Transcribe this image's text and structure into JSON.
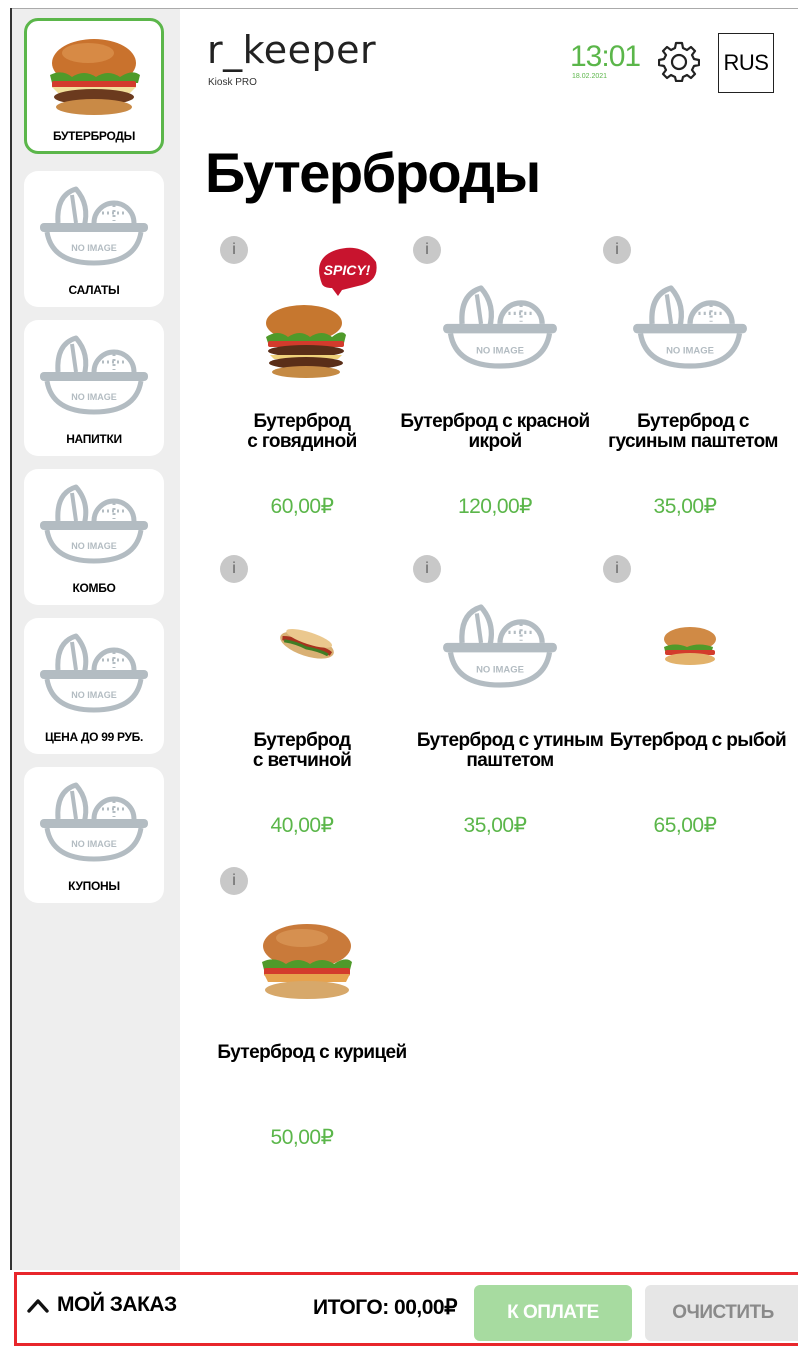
{
  "app": {
    "brand": "r_keeper",
    "brand_sub": "Kiosk PRO",
    "time": "13:01",
    "date": "18.02.2021",
    "language": "RUS",
    "accent_color": "#5bb64a",
    "icons": {
      "settings": "gear-icon"
    }
  },
  "sidebar": {
    "items": [
      {
        "label": "БУТЕРБРОДЫ",
        "image": "burger",
        "active": true
      },
      {
        "label": "САЛАТЫ",
        "image": "no-image",
        "no_image_text": "NO IMAGE"
      },
      {
        "label": "НАПИТКИ",
        "image": "no-image",
        "no_image_text": "NO IMAGE"
      },
      {
        "label": "КОМБО",
        "image": "no-image",
        "no_image_text": "NO IMAGE"
      },
      {
        "label": "ЦЕНА ДО 99 РУБ.",
        "image": "no-image",
        "no_image_text": "NO IMAGE"
      },
      {
        "label": "КУПОНЫ",
        "image": "no-image",
        "no_image_text": "NO IMAGE"
      }
    ]
  },
  "page": {
    "title": "Бутерброды"
  },
  "products": [
    {
      "name": "Бутерброд с говядиной",
      "price": "60,00₽",
      "info": "i",
      "image": "double-burger",
      "badge": "SPICY!"
    },
    {
      "name": "Бутерброд с красной икрой",
      "price": "120,00₽",
      "info": "i",
      "image": "no-image",
      "no_image_text": "NO IMAGE"
    },
    {
      "name": "Бутерброд с гусиным паштетом",
      "price": "35,00₽",
      "info": "i",
      "image": "no-image",
      "no_image_text": "NO IMAGE"
    },
    {
      "name": "Бутерброд с ветчиной",
      "price": "40,00₽",
      "info": "i",
      "image": "wrap"
    },
    {
      "name": "Бутерброд с утиным паштетом",
      "price": "35,00₽",
      "info": "i",
      "image": "no-image",
      "no_image_text": "NO IMAGE"
    },
    {
      "name": "Бутерброд с рыбой",
      "price": "65,00₽",
      "info": "i",
      "image": "small-burger"
    },
    {
      "name": "Бутерброд с курицей",
      "price": "50,00₽",
      "info": "i",
      "image": "chicken-burger"
    }
  ],
  "footer": {
    "order_label": "МОЙ ЗАКАЗ",
    "total": "ИТОГО: 00,00₽",
    "pay_label": "К ОПЛАТЕ",
    "clear_label": "ОЧИСТИТЬ"
  }
}
